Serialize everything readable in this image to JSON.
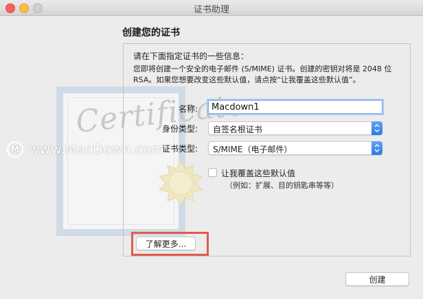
{
  "window": {
    "title": "证书助理"
  },
  "watermark": {
    "text": "www.MacDown.com"
  },
  "art": {
    "word": "Certificate"
  },
  "page": {
    "heading": "创建您的证书",
    "intro_line1": "请在下面指定证书的一些信息：",
    "intro_line2": "您即将创建一个安全的电子邮件 (S/MIME) 证书。创建的密钥对将是 2048 位 RSA。如果您想要改变这些默认值，请点按“让我覆盖这些默认值”。"
  },
  "form": {
    "name_label": "名称:",
    "name_value": "Macdown1",
    "identity_label": "身份类型:",
    "identity_value": "自签名根证书",
    "certtype_label": "证书类型:",
    "certtype_value": "S/MIME（电子邮件）",
    "override_label": "让我覆盖这些默认值",
    "override_checked": false,
    "override_hint": "（例如：扩展、目的钥匙串等等）"
  },
  "buttons": {
    "learn_more": "了解更多...",
    "create": "创建"
  },
  "colors": {
    "highlight_border": "#e05b4e",
    "select_accent": "#2f7be0",
    "focus_ring": "#a9c8f3"
  }
}
